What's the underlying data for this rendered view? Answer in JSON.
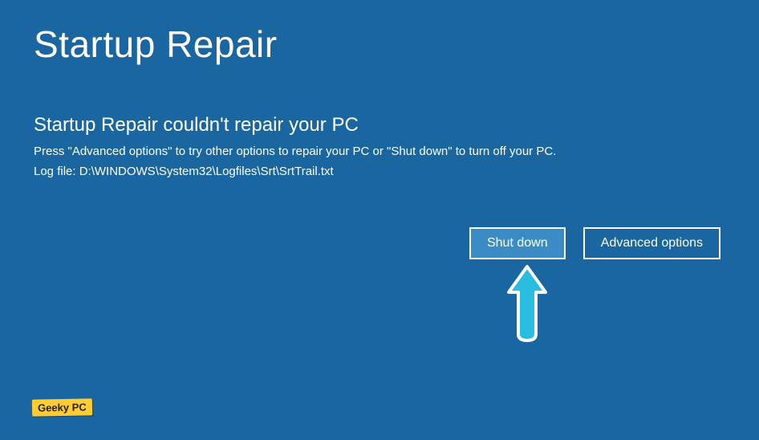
{
  "title": "Startup Repair",
  "subtitle": "Startup Repair couldn't repair your PC",
  "instruction": "Press \"Advanced options\" to try other options to repair your PC or \"Shut down\" to turn off your PC.",
  "logfile": "Log file: D:\\WINDOWS\\System32\\Logfiles\\Srt\\SrtTrail.txt",
  "buttons": {
    "shutdown": "Shut down",
    "advanced": "Advanced options"
  },
  "watermark": "Geeky PC"
}
